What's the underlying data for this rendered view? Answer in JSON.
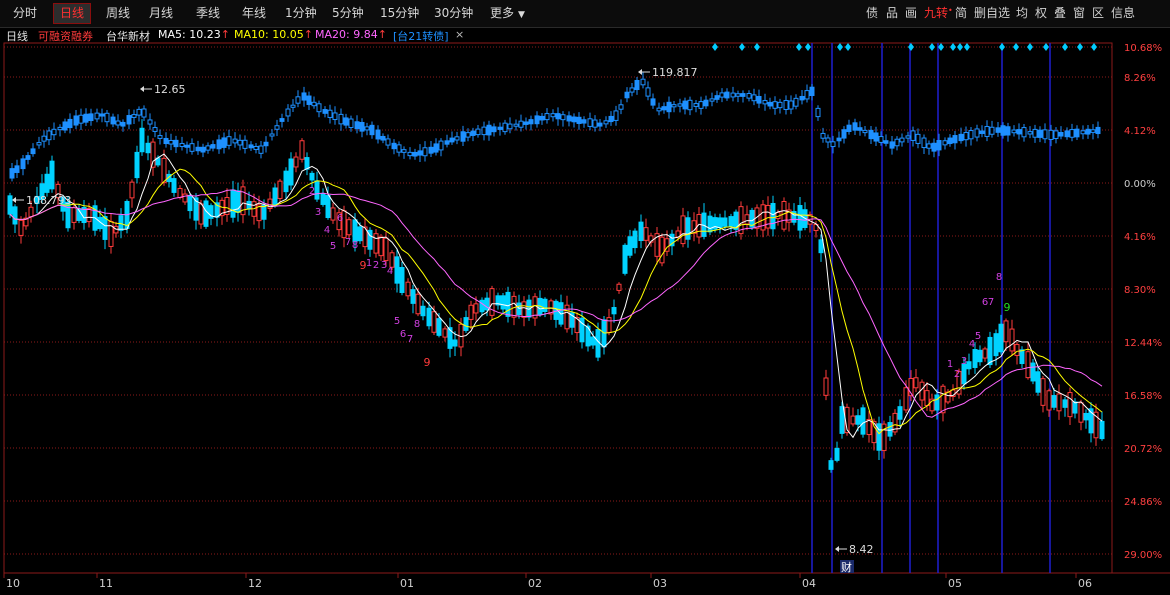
{
  "toolbar": {
    "tabs": [
      "分时",
      "日线",
      "周线",
      "月线",
      "季线",
      "年线",
      "1分钟",
      "5分钟",
      "15分钟",
      "30分钟",
      "更多"
    ],
    "active_tab": "日线",
    "right_tools": [
      "债",
      "品",
      "画",
      "九转",
      "简",
      "删自选",
      "均",
      "权",
      "叠",
      "窗",
      "区",
      "信息"
    ]
  },
  "infobar": {
    "period": "日线",
    "margin_tag": "可融资融券",
    "stock_name": "台华新材",
    "ma5_label": "MA5:",
    "ma5_value": "10.23",
    "ma10_label": "MA10:",
    "ma10_value": "10.05",
    "ma20_label": "MA20:",
    "ma20_value": "9.84",
    "arrow_up": "↑",
    "bond_tag": "[台21转债]",
    "close_symbol": "×"
  },
  "colors": {
    "up": "#ff3b3b",
    "down": "#00d2ff",
    "bond": "#1e90ff",
    "ma5": "#ffffff",
    "ma10": "#ffff00",
    "ma20": "#ff66ff",
    "grid": "#8b1a1a",
    "vline": "#1f1fd0",
    "diamond": "#00ccff"
  },
  "chart_data": {
    "type": "candlestick",
    "x_tick_labels": [
      "10",
      "11",
      "12",
      "01",
      "02",
      "03",
      "04",
      "05",
      "06"
    ],
    "y_tick_labels": [
      "10.68%",
      "8.26%",
      "4.12%",
      "0.00%",
      "4.16%",
      "8.30%",
      "12.44%",
      "16.58%",
      "20.72%",
      "24.86%",
      "29.00%"
    ],
    "annotations": {
      "stock_high": "12.65",
      "bond_start": "108.793",
      "bond_high": "119.817",
      "stock_low": "8.42",
      "finance_tag": "财",
      "nine_turn_up": "9",
      "nine_turn_down": "9"
    },
    "nine_turn_digits": [
      "1",
      "2",
      "3",
      "4",
      "5",
      "6",
      "7",
      "8"
    ]
  }
}
